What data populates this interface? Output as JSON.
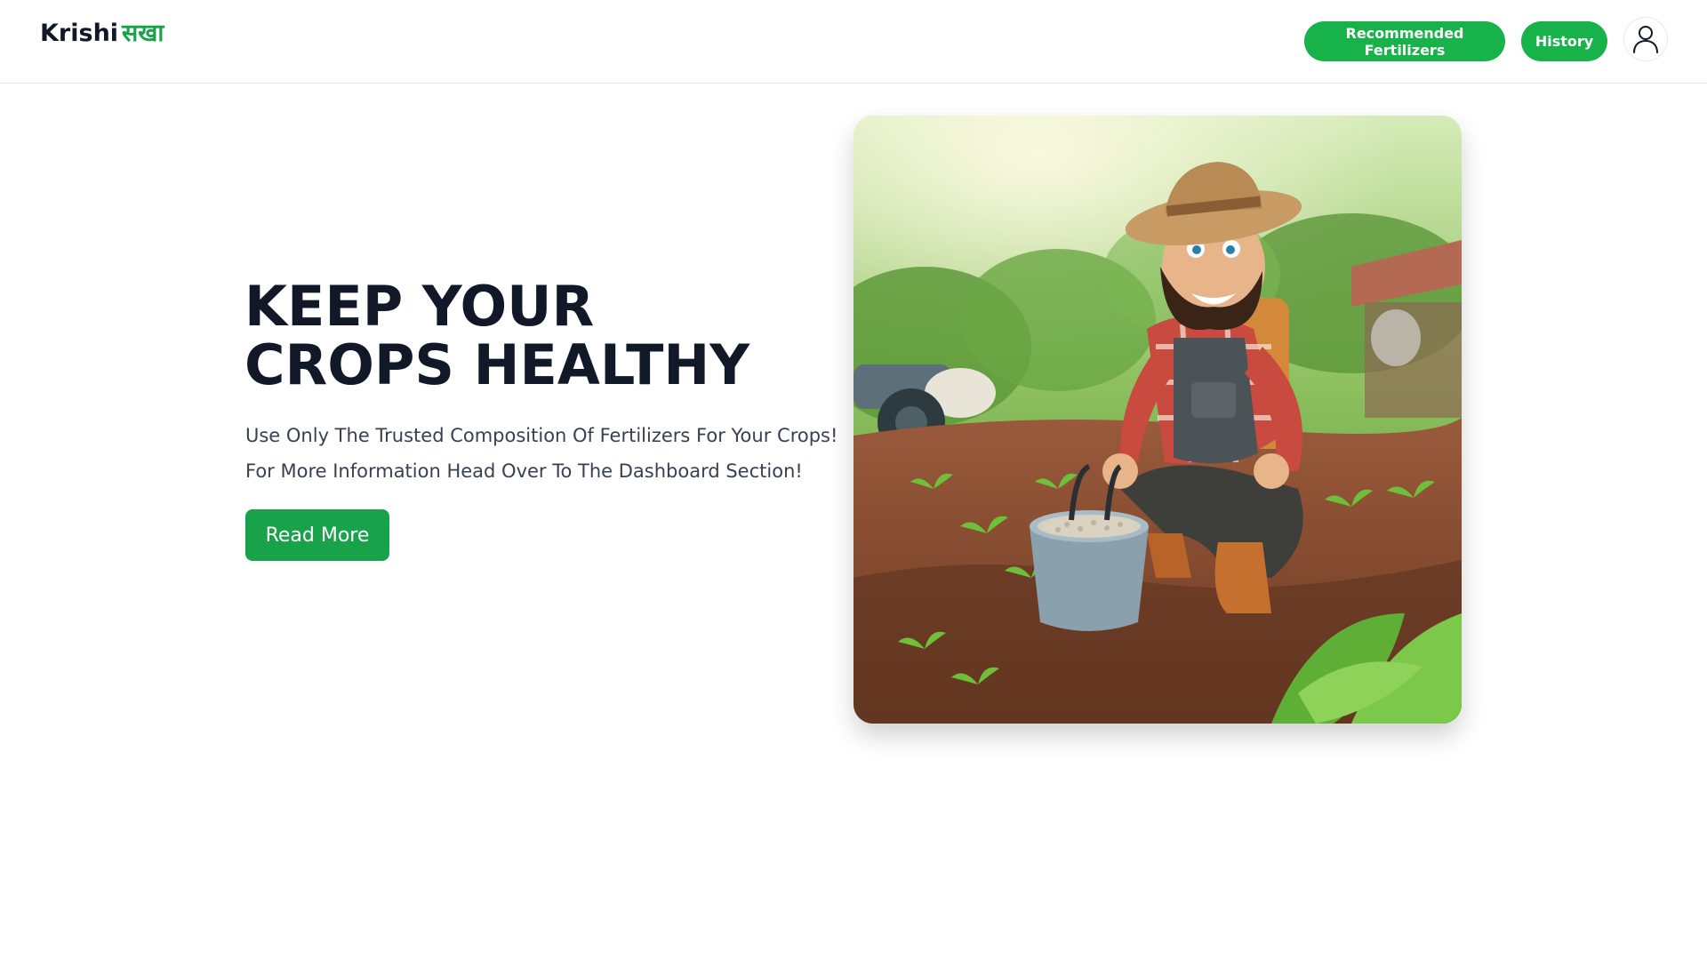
{
  "header": {
    "logo_en": "Krishi",
    "logo_hi": "सखा",
    "nav": {
      "recommended_label": "Recommended Fertilizers",
      "history_label": "History"
    },
    "profile_icon": "user-icon"
  },
  "hero": {
    "title_line1": "KEEP YOUR",
    "title_line2": "CROPS HEALTHY",
    "subtitle_line1": "Use Only The Trusted Composition Of Fertilizers For Your Crops!",
    "subtitle_line2": "For More Information Head Over To The Dashboard Section!",
    "cta_label": "Read More",
    "image_alt": "Cartoon farmer adding fertilizer to seedlings in a field"
  },
  "colors": {
    "accent_green": "#18b24a",
    "cta_green": "#18a34a",
    "title": "#111827",
    "text": "#374151",
    "logo_hindi": "#16a34a"
  }
}
